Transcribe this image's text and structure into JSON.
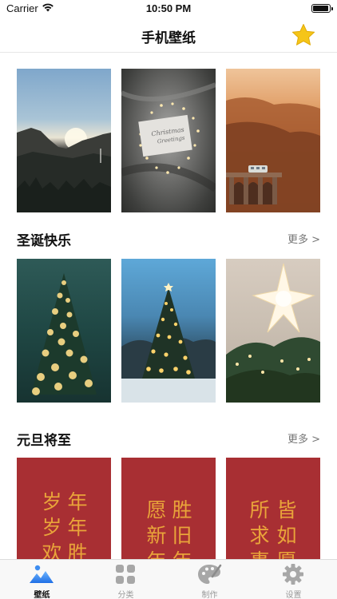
{
  "status": {
    "carrier": "Carrier",
    "time": "10:50 PM"
  },
  "nav": {
    "title": "手机壁纸",
    "favorites_icon": "star-icon"
  },
  "featured": {
    "icons": [
      "mountain-sunset",
      "christmas-card-fabric",
      "autumn-train-bridge"
    ]
  },
  "sections": [
    {
      "name": "圣诞快乐",
      "more": "更多 >",
      "wallpapers": [
        "christmas-tree-bokeh",
        "christmas-tree-blue-sky",
        "star-ornament-tree"
      ]
    },
    {
      "name": "元旦将至",
      "more": "更多 >",
      "wallpapers": [
        {
          "col1": "岁岁欢愉",
          "col2": "年年胜意"
        },
        {
          "col1": "愿新年",
          "col2": "胜旧年"
        },
        {
          "col1": "所求事",
          "col2": "皆如愿"
        }
      ]
    }
  ],
  "tabs": [
    {
      "label": "壁纸",
      "icon": "wallpaper-icon",
      "active": true
    },
    {
      "label": "分类",
      "icon": "category-icon",
      "active": false
    },
    {
      "label": "制作",
      "icon": "palette-icon",
      "active": false
    },
    {
      "label": "设置",
      "icon": "settings-icon",
      "active": false
    }
  ],
  "colors": {
    "accent_star": "#f5c518",
    "calligraphy": "#e9a43a",
    "red_card": "#a82f33"
  }
}
